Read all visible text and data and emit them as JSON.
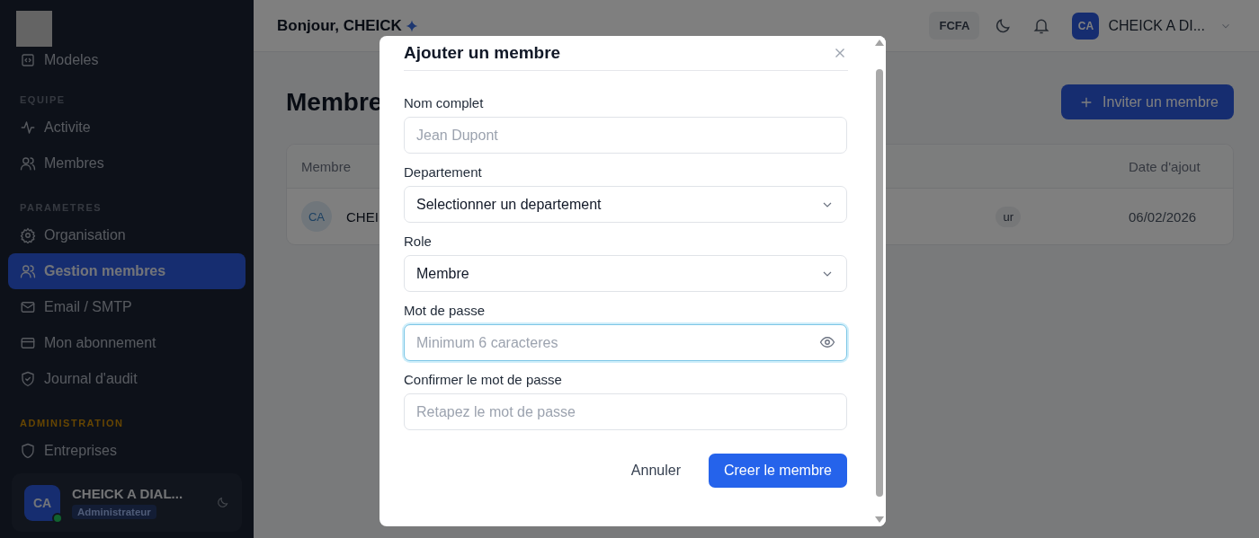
{
  "sidebar": {
    "items": [
      {
        "kind": "link",
        "label": "Modeles",
        "selected": false
      },
      {
        "kind": "heading",
        "label": "EQUIPE",
        "highlighted": false
      },
      {
        "kind": "link",
        "label": "Activite",
        "selected": false
      },
      {
        "kind": "link",
        "label": "Membres",
        "selected": false
      },
      {
        "kind": "heading",
        "label": "PARAMETRES",
        "highlighted": false
      },
      {
        "kind": "link",
        "label": "Organisation",
        "selected": false
      },
      {
        "kind": "link",
        "label": "Gestion membres",
        "selected": true
      },
      {
        "kind": "link",
        "label": "Email / SMTP",
        "selected": false
      },
      {
        "kind": "link",
        "label": "Mon abonnement",
        "selected": false
      },
      {
        "kind": "link",
        "label": "Journal d'audit",
        "selected": false
      },
      {
        "kind": "heading",
        "label": "ADMINISTRATION",
        "highlighted": true
      },
      {
        "kind": "link",
        "label": "Entreprises",
        "selected": false
      }
    ],
    "user": {
      "initials": "CA",
      "name": "CHEICK A DIAL...",
      "role": "Administrateur",
      "online": true
    }
  },
  "header": {
    "greeting": "Bonjour, CHEICK",
    "currency": "FCFA",
    "user": {
      "initials": "CA",
      "name": "CHEICK A DI..."
    }
  },
  "page": {
    "title": "Membre",
    "invite_button": "Inviter un membre",
    "table": {
      "columns": [
        "Membre",
        "Date d'ajout"
      ],
      "rows": [
        {
          "initials": "CA",
          "name": "CHEI",
          "role": "ur",
          "date": "06/02/2026"
        }
      ]
    }
  },
  "modal": {
    "title": "Ajouter un membre",
    "fields": [
      {
        "kind": "text",
        "label": "Nom complet",
        "placeholder": "Jean Dupont",
        "focused": false
      },
      {
        "kind": "select",
        "label": "Departement",
        "value": "Selectionner un departement",
        "focused": false
      },
      {
        "kind": "select",
        "label": "Role",
        "value": "Membre",
        "focused": false
      },
      {
        "kind": "password",
        "label": "Mot de passe",
        "placeholder": "Minimum 6 caracteres",
        "focused": true
      },
      {
        "kind": "text",
        "label": "Confirmer le mot de passe",
        "placeholder": "Retapez le mot de passe",
        "focused": false
      }
    ],
    "cancel_button": "Annuler",
    "submit_button": "Creer le membre"
  }
}
